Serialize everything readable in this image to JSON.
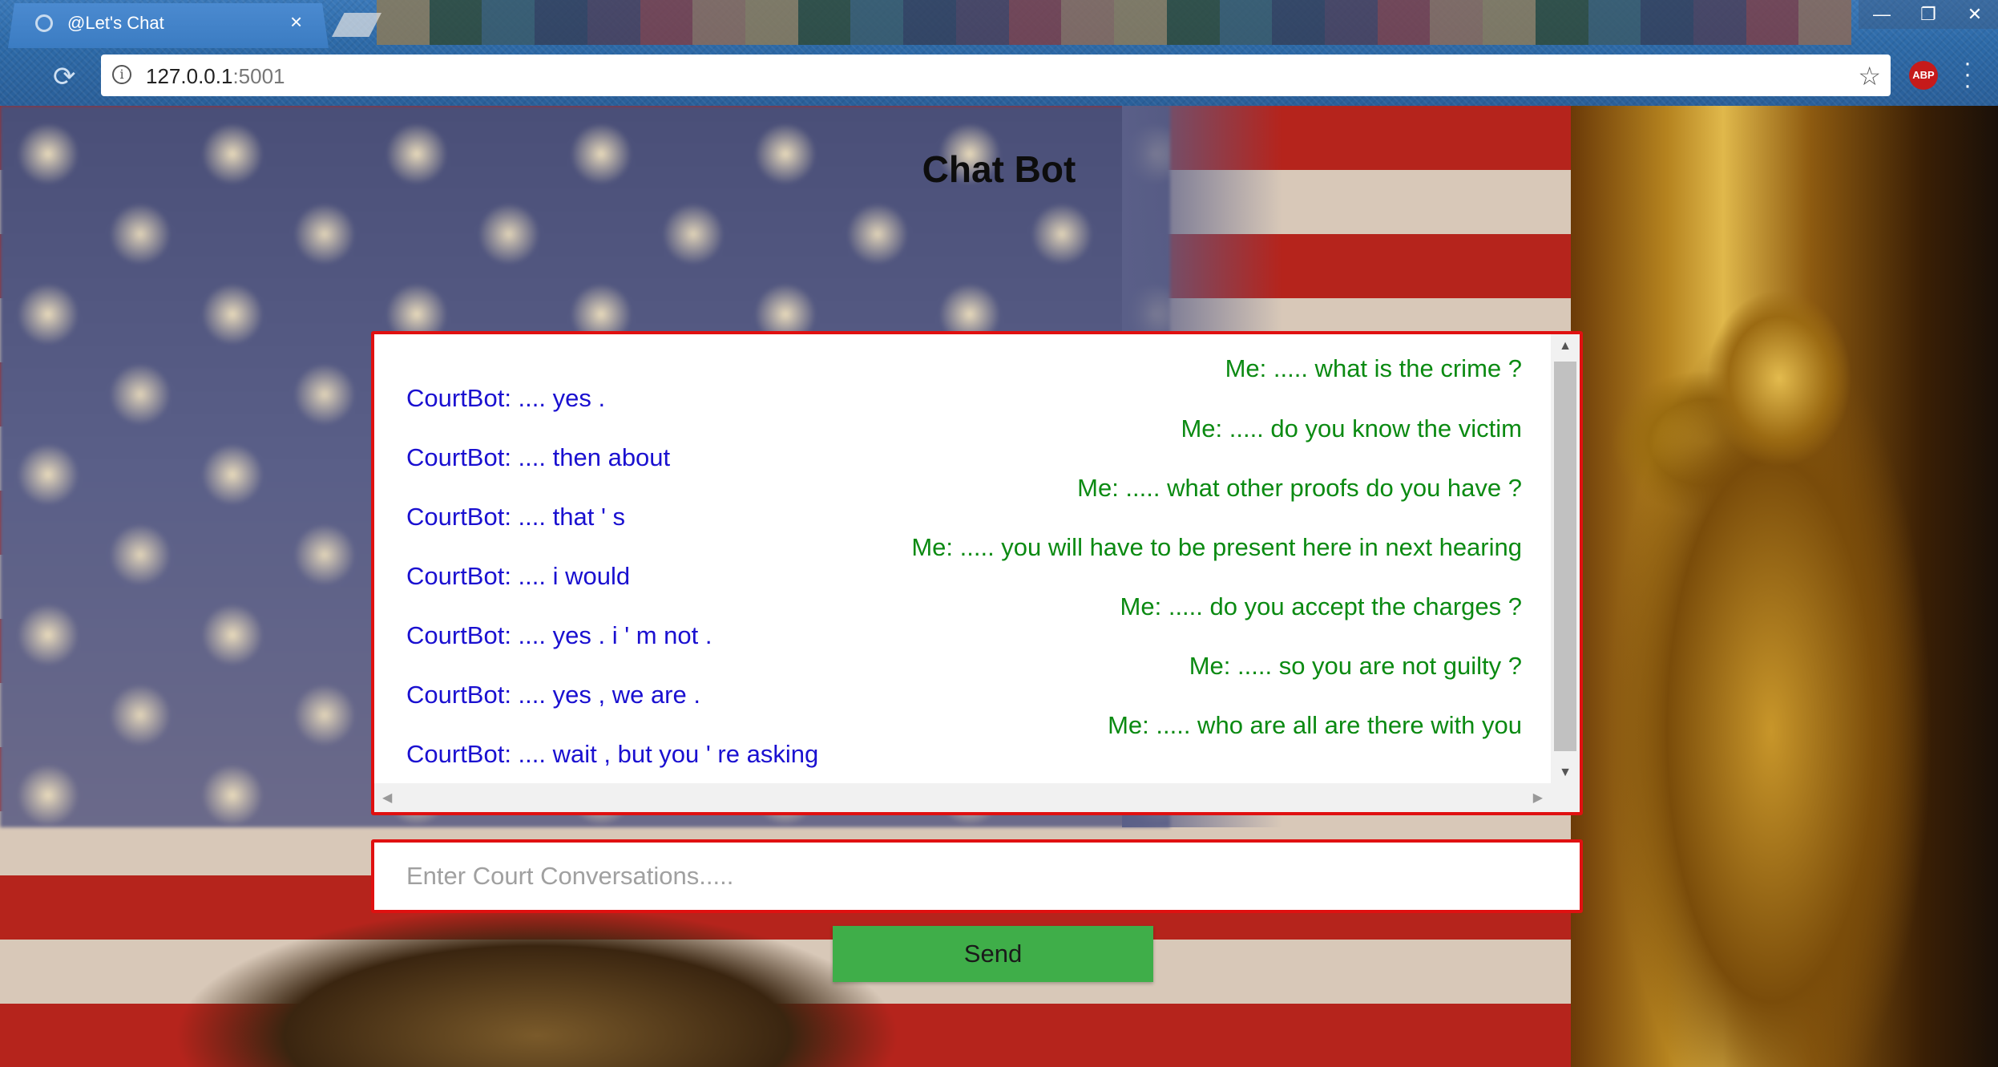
{
  "browser": {
    "tab_title": "@Let's Chat",
    "tab_close": "×",
    "url_host": "127.0.0.1",
    "url_port": ":5001",
    "abp_label": "ABP",
    "window_controls": [
      "—",
      "❐",
      "✕"
    ]
  },
  "page": {
    "title": "Chat Bot"
  },
  "chat": {
    "bot_messages": [
      "CourtBot: .... yes .",
      "CourtBot: .... then about",
      "CourtBot: .... that ' s",
      "CourtBot: .... i would",
      "CourtBot: .... yes . i ' m not .",
      "CourtBot: .... yes , we are .",
      "CourtBot: .... wait , but you ' re asking"
    ],
    "me_messages": [
      "Me: ..... what is the crime ?",
      "Me: ..... do you know the victim",
      "Me: ..... what other proofs do you have ?",
      "Me: ..... you will have to be present here in next hearing",
      "Me: ..... do you accept the charges ?",
      "Me: ..... so you are not guilty ?",
      "Me: ..... who are all are there with you"
    ],
    "colors": {
      "bot": "#1a10d0",
      "me": "#0b8a12",
      "border": "#e01010"
    }
  },
  "input": {
    "placeholder": "Enter Court Conversations.....",
    "value": ""
  },
  "send_button": {
    "label": "Send",
    "color": "#3fae49"
  }
}
